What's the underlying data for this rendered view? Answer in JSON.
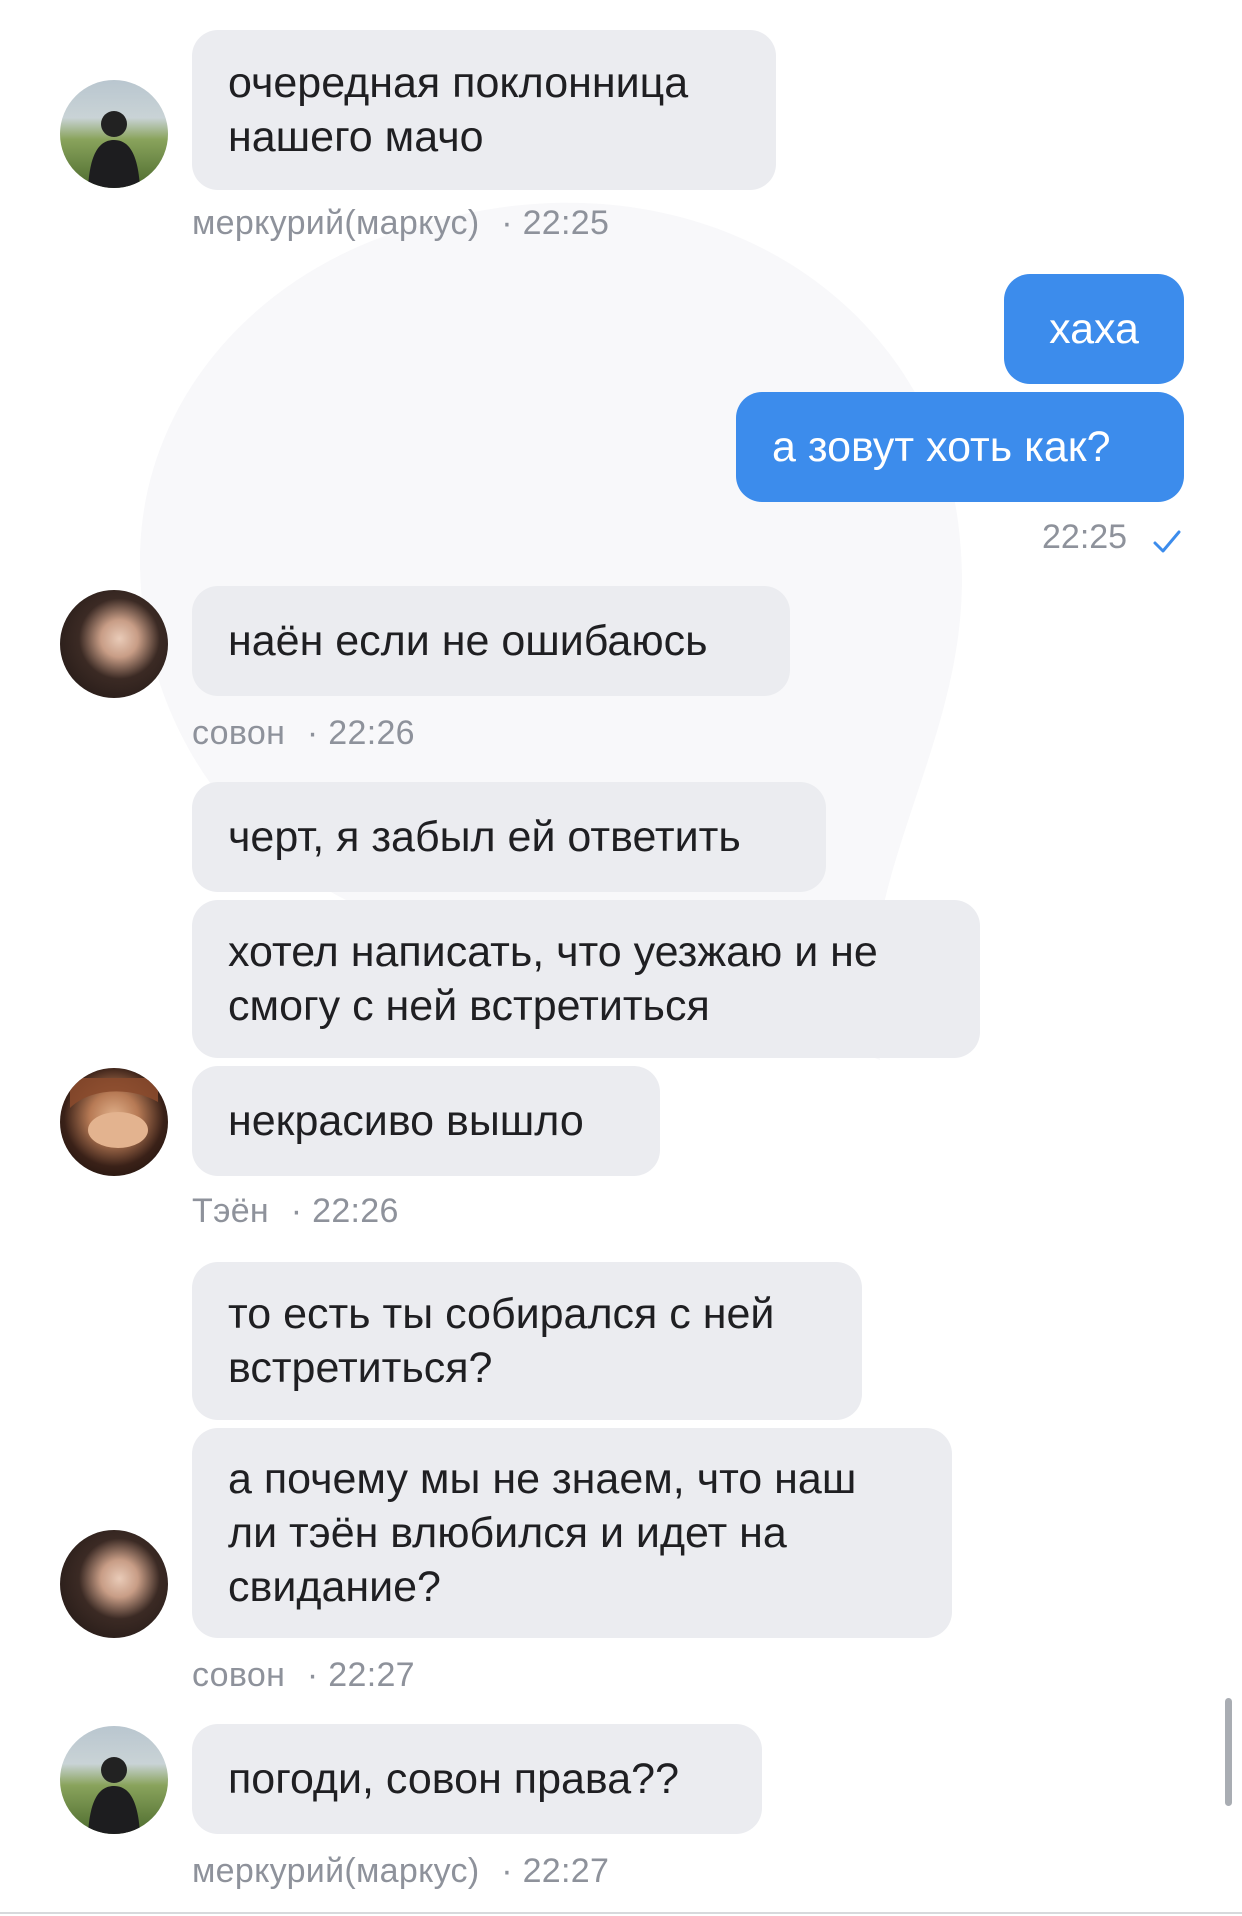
{
  "messages": [
    {
      "id": "m1",
      "text_lines": [
        "очередная поклонница",
        "нашего мачо"
      ]
    },
    {
      "id": "m2",
      "text_lines": [
        "хаха"
      ]
    },
    {
      "id": "m3",
      "text_lines": [
        "а зовут хоть как?"
      ]
    },
    {
      "id": "m4",
      "text_lines": [
        "наён если не ошибаюсь"
      ]
    },
    {
      "id": "m5",
      "text_lines": [
        "черт, я забыл ей ответить"
      ]
    },
    {
      "id": "m6",
      "text_lines": [
        "хотел написать, что уезжаю и не",
        "смогу с ней встретиться"
      ]
    },
    {
      "id": "m7",
      "text_lines": [
        "некрасиво вышло"
      ]
    },
    {
      "id": "m8",
      "text_lines": [
        "то есть ты собирался с ней",
        "встретиться?"
      ]
    },
    {
      "id": "m9",
      "text_lines": [
        "а почему мы не знаем, что наш",
        "ли тэён влюбился и идет на",
        "свидание?"
      ]
    },
    {
      "id": "m10",
      "text_lines": [
        "погоди, совон права??"
      ]
    }
  ],
  "meta": {
    "g1": {
      "sender": "меркурий(маркус)",
      "time": "· 22:25"
    },
    "out": {
      "time": "22:25",
      "status": "read-check-icon"
    },
    "g2": {
      "sender": "совон",
      "time": "· 22:26"
    },
    "g3": {
      "sender": "Тэён",
      "time": "· 22:26"
    },
    "g4": {
      "sender": "совон",
      "time": "· 22:27"
    },
    "g5": {
      "sender": "меркурий(маркус)",
      "time": "· 22:27"
    }
  },
  "colors": {
    "incoming": "#ebecf0",
    "outgoing": "#3c8cec",
    "meta": "#8e929b"
  }
}
